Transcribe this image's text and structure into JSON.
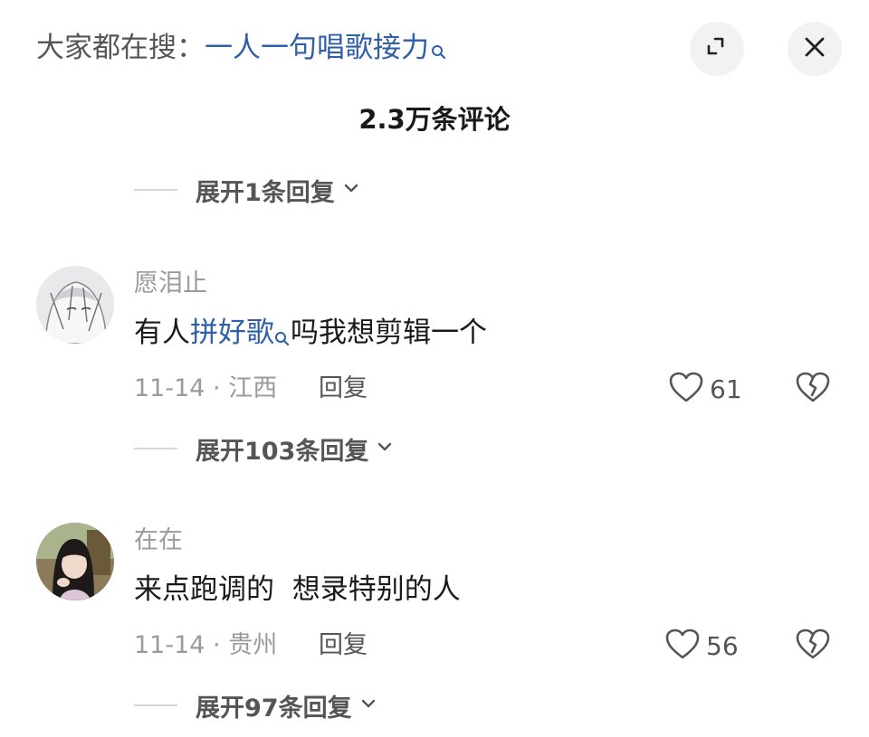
{
  "header": {
    "search_prefix": "大家都在搜：",
    "search_query": "一人一句唱歌接力",
    "search_icon": "search-icon",
    "expand_icon": "expand-icon",
    "close_icon": "close-icon"
  },
  "comment_count": "2.3万条评论",
  "top_expand": {
    "label": "展开1条回复"
  },
  "comments": [
    {
      "username": "愿泪止",
      "text_before": "有人",
      "text_link": "拼好歌",
      "text_after": "吗我想剪辑一个",
      "date_location": "11-14 · 江西",
      "reply_label": "回复",
      "likes": "61",
      "expand_label": "展开103条回复"
    },
    {
      "username": "在在",
      "text_before": "来点跑调的  想录特别的人",
      "date_location": "11-14 · 贵州",
      "reply_label": "回复",
      "likes": "56",
      "expand_label": "展开97条回复"
    }
  ],
  "colors": {
    "link": "#2f5fa8",
    "muted": "#9a9a9a",
    "text": "#1a1a1a"
  }
}
